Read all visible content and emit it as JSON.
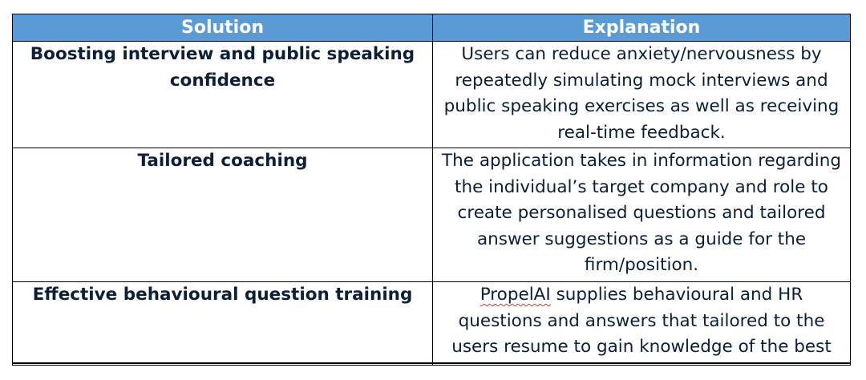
{
  "table": {
    "headers": {
      "solution": "Solution",
      "explanation": "Explanation"
    },
    "rows": [
      {
        "solution": "Boosting interview and public speaking confidence",
        "explanation": "Users can reduce anxiety/nervousness by repeatedly simulating mock interviews and public speaking exercises as well as receiving real-time feedback."
      },
      {
        "solution": "Tailored coaching",
        "explanation": "The application takes in information regarding the individual’s target company and role to create personalised questions and tailored answer suggestions as a guide for the firm/position."
      },
      {
        "solution": "Effective behavioural question training",
        "explanation_flagged_word": "PropelAI",
        "explanation": " supplies behavioural and HR questions and answers that tailored to the users resume to gain knowledge of the best"
      }
    ]
  },
  "colors": {
    "header_bg": "#5b9bd5",
    "header_text": "#ffffff",
    "body_text": "#0b1f3a",
    "spellcheck_underline": "#d9342b"
  }
}
